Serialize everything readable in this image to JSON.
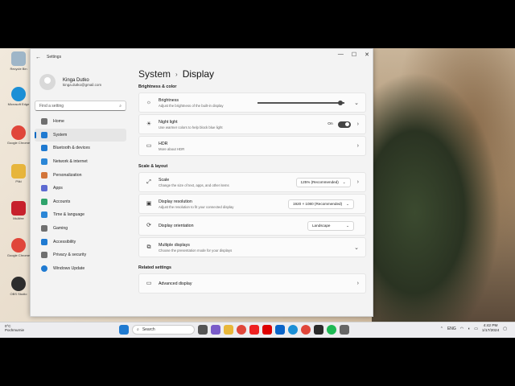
{
  "window": {
    "title": "Settings"
  },
  "user": {
    "name": "Kinga Dutko",
    "email": "kinga.dutko@gmail.com"
  },
  "search": {
    "placeholder": "Find a setting"
  },
  "nav": [
    {
      "label": "Home",
      "icon": "home-icon",
      "color": "#6f6f6f"
    },
    {
      "label": "System",
      "icon": "monitor-icon",
      "color": "#1f7ad1",
      "active": true
    },
    {
      "label": "Bluetooth & devices",
      "icon": "bluetooth-icon",
      "color": "#1f7ad1"
    },
    {
      "label": "Network & internet",
      "icon": "network-icon",
      "color": "#2b86d6"
    },
    {
      "label": "Personalization",
      "icon": "brush-icon",
      "color": "#d2753a"
    },
    {
      "label": "Apps",
      "icon": "apps-icon",
      "color": "#5d6ad1"
    },
    {
      "label": "Accounts",
      "icon": "person-icon",
      "color": "#2fa36b"
    },
    {
      "label": "Time & language",
      "icon": "globe-icon",
      "color": "#2b86d6"
    },
    {
      "label": "Gaming",
      "icon": "controller-icon",
      "color": "#6f6f6f"
    },
    {
      "label": "Accessibility",
      "icon": "accessibility-icon",
      "color": "#1f7ad1"
    },
    {
      "label": "Privacy & security",
      "icon": "shield-icon",
      "color": "#6f6f6f"
    },
    {
      "label": "Windows Update",
      "icon": "update-icon",
      "color": "#1f7ad1"
    }
  ],
  "breadcrumb": {
    "parent": "System",
    "current": "Display"
  },
  "sections": {
    "brightness": "Brightness & color",
    "scale": "Scale & layout",
    "related": "Related settings"
  },
  "cards": {
    "brightness": {
      "title": "Brightness",
      "desc": "Adjust the brightness of the built-in display",
      "value": 0.95
    },
    "nightlight": {
      "title": "Night light",
      "desc": "Use warmer colors to help block blue light",
      "state": "On"
    },
    "hdr": {
      "title": "HDR",
      "desc": "More about HDR"
    },
    "scale": {
      "title": "Scale",
      "desc": "Change the size of text, apps, and other items",
      "value": "125% (Recommended)"
    },
    "resolution": {
      "title": "Display resolution",
      "desc": "Adjust the resolution to fit your connected display",
      "value": "1920 × 1080 (Recommended)"
    },
    "orientation": {
      "title": "Display orientation",
      "value": "Landscape"
    },
    "multiple": {
      "title": "Multiple displays",
      "desc": "Choose the presentation mode for your displays"
    },
    "advanced": {
      "title": "Advanced display"
    }
  },
  "desktop_icons": [
    {
      "label": "Recycle Bin",
      "color": "#9fb6c8"
    },
    {
      "label": "Microsoft Edge",
      "color": "#1b8fd6"
    },
    {
      "label": "Google Chrome",
      "color": "#e0463a"
    },
    {
      "label": "Pliki",
      "color": "#e7b53c"
    },
    {
      "label": "McAfee",
      "color": "#c7212c"
    },
    {
      "label": "Google Chrome",
      "color": "#e0463a"
    },
    {
      "label": "OBS Studio",
      "color": "#2d2d2d"
    }
  ],
  "taskbar": {
    "weather_temp": "0°C",
    "weather_desc": "Pochmurnie",
    "search_label": "Search",
    "lang": "ENG",
    "time": "4:42 PM",
    "date": "1/17/2024"
  }
}
